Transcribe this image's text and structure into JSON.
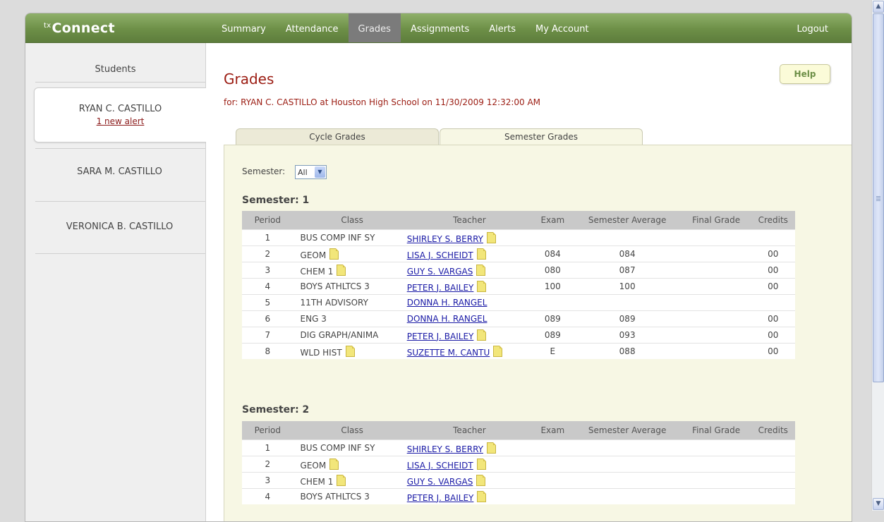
{
  "app": {
    "logo_prefix": "tx",
    "logo_text": "Connect"
  },
  "nav": {
    "items": [
      {
        "label": "Summary"
      },
      {
        "label": "Attendance"
      },
      {
        "label": "Grades"
      },
      {
        "label": "Assignments"
      },
      {
        "label": "Alerts"
      },
      {
        "label": "My Account"
      }
    ],
    "active": "Grades",
    "logout": "Logout"
  },
  "sidebar": {
    "heading": "Students",
    "students": [
      {
        "name": "RYAN C. CASTILLO",
        "alert": "1 new alert",
        "selected": true
      },
      {
        "name": "SARA M. CASTILLO"
      },
      {
        "name": "VERONICA B. CASTILLO"
      }
    ]
  },
  "main": {
    "title": "Grades",
    "subtitle": "for: RYAN C. CASTILLO at Houston High School on 11/30/2009 12:32:00 AM",
    "help": "Help",
    "tabs": [
      {
        "label": "Cycle Grades"
      },
      {
        "label": "Semester Grades",
        "active": true
      }
    ],
    "semester_filter": {
      "label": "Semester:",
      "value": "All"
    },
    "columns": [
      "Period",
      "Class",
      "Teacher",
      "Exam",
      "Semester Average",
      "Final Grade",
      "Credits"
    ],
    "semesters": [
      {
        "label": "Semester: 1",
        "rows": [
          {
            "period": "1",
            "class": "BUS COMP INF SY",
            "class_note": false,
            "teacher": "SHIRLEY S. BERRY",
            "teacher_note": true,
            "exam": "",
            "avg": "",
            "final": "",
            "credits": ""
          },
          {
            "period": "2",
            "class": "GEOM",
            "class_note": true,
            "teacher": "LISA J. SCHEIDT",
            "teacher_note": true,
            "exam": "084",
            "avg": "084",
            "final": "",
            "credits": "00"
          },
          {
            "period": "3",
            "class": "CHEM 1",
            "class_note": true,
            "teacher": "GUY S. VARGAS",
            "teacher_note": true,
            "exam": "080",
            "avg": "087",
            "final": "",
            "credits": "00"
          },
          {
            "period": "4",
            "class": "BOYS ATHLTCS 3",
            "class_note": false,
            "teacher": "PETER J. BAILEY",
            "teacher_note": true,
            "exam": "100",
            "avg": "100",
            "final": "",
            "credits": "00"
          },
          {
            "period": "5",
            "class": "11TH ADVISORY",
            "class_note": false,
            "teacher": "DONNA H. RANGEL",
            "teacher_note": false,
            "exam": "",
            "avg": "",
            "final": "",
            "credits": ""
          },
          {
            "period": "6",
            "class": "ENG 3",
            "class_note": false,
            "teacher": "DONNA H. RANGEL",
            "teacher_note": false,
            "exam": "089",
            "avg": "089",
            "final": "",
            "credits": "00"
          },
          {
            "period": "7",
            "class": "DIG GRAPH/ANIMA",
            "class_note": false,
            "teacher": "PETER J. BAILEY",
            "teacher_note": true,
            "exam": "089",
            "avg": "093",
            "final": "",
            "credits": "00"
          },
          {
            "period": "8",
            "class": "WLD HIST",
            "class_note": true,
            "teacher": "SUZETTE M. CANTU",
            "teacher_note": true,
            "exam": "E",
            "avg": "088",
            "final": "",
            "credits": "00"
          }
        ]
      },
      {
        "label": "Semester: 2",
        "rows": [
          {
            "period": "1",
            "class": "BUS COMP INF SY",
            "class_note": false,
            "teacher": "SHIRLEY S. BERRY",
            "teacher_note": true,
            "exam": "",
            "avg": "",
            "final": "",
            "credits": ""
          },
          {
            "period": "2",
            "class": "GEOM",
            "class_note": true,
            "teacher": "LISA J. SCHEIDT",
            "teacher_note": true,
            "exam": "",
            "avg": "",
            "final": "",
            "credits": ""
          },
          {
            "period": "3",
            "class": "CHEM 1",
            "class_note": true,
            "teacher": "GUY S. VARGAS",
            "teacher_note": true,
            "exam": "",
            "avg": "",
            "final": "",
            "credits": ""
          },
          {
            "period": "4",
            "class": "BOYS ATHLTCS 3",
            "class_note": false,
            "teacher": "PETER J. BAILEY",
            "teacher_note": true,
            "exam": "",
            "avg": "",
            "final": "",
            "credits": ""
          }
        ]
      }
    ]
  },
  "colors": {
    "brand_green": "#6d8f47",
    "title_red": "#9b1c12",
    "panel": "#f7f7e4",
    "link": "#1a1aa6"
  }
}
